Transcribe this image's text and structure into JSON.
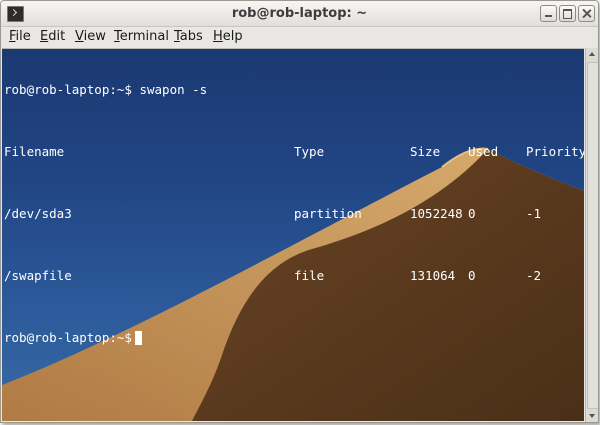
{
  "window": {
    "title": "rob@rob-laptop: ~",
    "icon": "terminal-icon",
    "controls": [
      "minimize-icon",
      "maximize-icon",
      "close-icon"
    ]
  },
  "menubar": {
    "items": [
      {
        "label": "File",
        "accel": "F"
      },
      {
        "label": "Edit",
        "accel": "E"
      },
      {
        "label": "View",
        "accel": "V"
      },
      {
        "label": "Terminal",
        "accel": "T"
      },
      {
        "label": "Tabs",
        "accel": "T"
      },
      {
        "label": "Help",
        "accel": "H"
      }
    ]
  },
  "terminal": {
    "prompt": "rob@rob-laptop:~$",
    "command": "swapon -s",
    "table": {
      "headers": [
        "Filename",
        "Type",
        "Size",
        "Used",
        "Priority"
      ],
      "rows": [
        [
          "/dev/sda3",
          "partition",
          "1052248",
          "0",
          "-1"
        ],
        [
          "/swapfile",
          "file",
          "131064",
          "0",
          "-2"
        ]
      ]
    },
    "colors": {
      "sky_top": "#1b3972",
      "sky_bottom": "#3a6aa6",
      "dune_light": "#c89a60",
      "dune_shadow": "#5e3c1f",
      "text": "#ffffff"
    }
  }
}
